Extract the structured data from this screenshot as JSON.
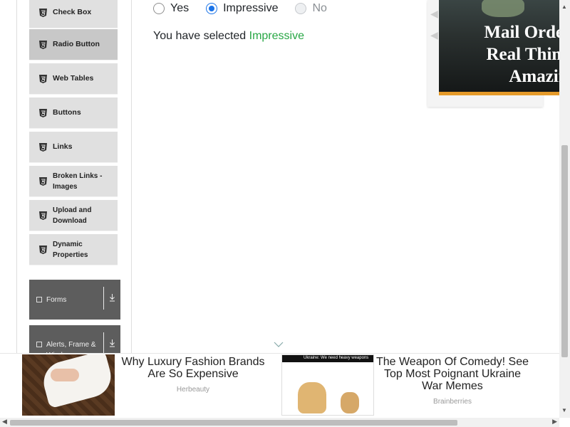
{
  "sidebar": {
    "items": [
      {
        "label": "Check Box"
      },
      {
        "label": "Radio Button"
      },
      {
        "label": "Web Tables"
      },
      {
        "label": "Buttons"
      },
      {
        "label": "Links"
      },
      {
        "label": "Broken Links - Images"
      },
      {
        "label": "Upload and Download"
      },
      {
        "label": "Dynamic Properties"
      }
    ],
    "active": "Radio Button",
    "groups": [
      {
        "label": "Forms"
      },
      {
        "label": "Alerts, Frame & Windows"
      }
    ]
  },
  "radio": {
    "options": [
      {
        "label": "Yes",
        "checked": false,
        "disabled": false
      },
      {
        "label": "Impressive",
        "checked": true,
        "disabled": false
      },
      {
        "label": "No",
        "checked": false,
        "disabled": true
      }
    ],
    "result_prefix": "You have selected ",
    "result_value": "Impressive"
  },
  "top_ad": {
    "headline_line1": "Mail Order W",
    "headline_line2": "Real Thing, T",
    "headline_line3": "Amazin"
  },
  "bottom_ad": {
    "cards": [
      {
        "title": "Why Luxury Fashion Brands Are So Expensive",
        "source": "Herbeauty"
      },
      {
        "title": "The Weapon Of Comedy! See Top Most Poignant Ukraine War Memes",
        "source": "Brainberries"
      }
    ],
    "meme_caption": "Ukraine: We need heavy weapons"
  },
  "colors": {
    "accent": "#1a73e8",
    "selected_value": "#28a745",
    "ad_stripe": "#e59a2a"
  }
}
